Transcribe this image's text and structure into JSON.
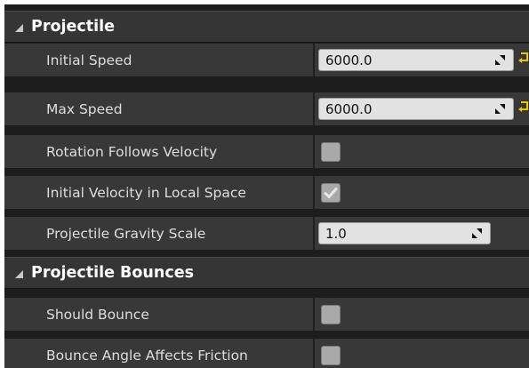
{
  "sections": [
    {
      "title": "Projectile",
      "rows": [
        {
          "label": "Initial Speed",
          "type": "number",
          "value": "6000.0",
          "has_reset": true
        },
        {
          "label": "Max Speed",
          "type": "number",
          "value": "6000.0",
          "has_reset": true
        },
        {
          "label": "Rotation Follows Velocity",
          "type": "checkbox",
          "checked": false
        },
        {
          "label": "Initial Velocity in Local Space",
          "type": "checkbox",
          "checked": true
        },
        {
          "label": "Projectile Gravity Scale",
          "type": "number",
          "value": "1.0",
          "has_reset": false
        }
      ]
    },
    {
      "title": "Projectile Bounces",
      "rows": [
        {
          "label": "Should Bounce",
          "type": "checkbox",
          "checked": false
        },
        {
          "label": "Bounce Angle Affects Friction",
          "type": "checkbox",
          "checked": false
        }
      ]
    }
  ],
  "icons": {
    "expand": "expanded-triangle-icon",
    "spin": "spin-arrows-icon",
    "reset": "reset-to-default-icon",
    "check": "checkmark-icon"
  },
  "colors": {
    "panel_bg": "#1d1d1d",
    "header_bg": "#353535",
    "row_bg": "#383838",
    "input_bg": "#e2e2e2",
    "checkbox_bg": "#a9a9a9",
    "reset_arrow": "#e8c500"
  }
}
